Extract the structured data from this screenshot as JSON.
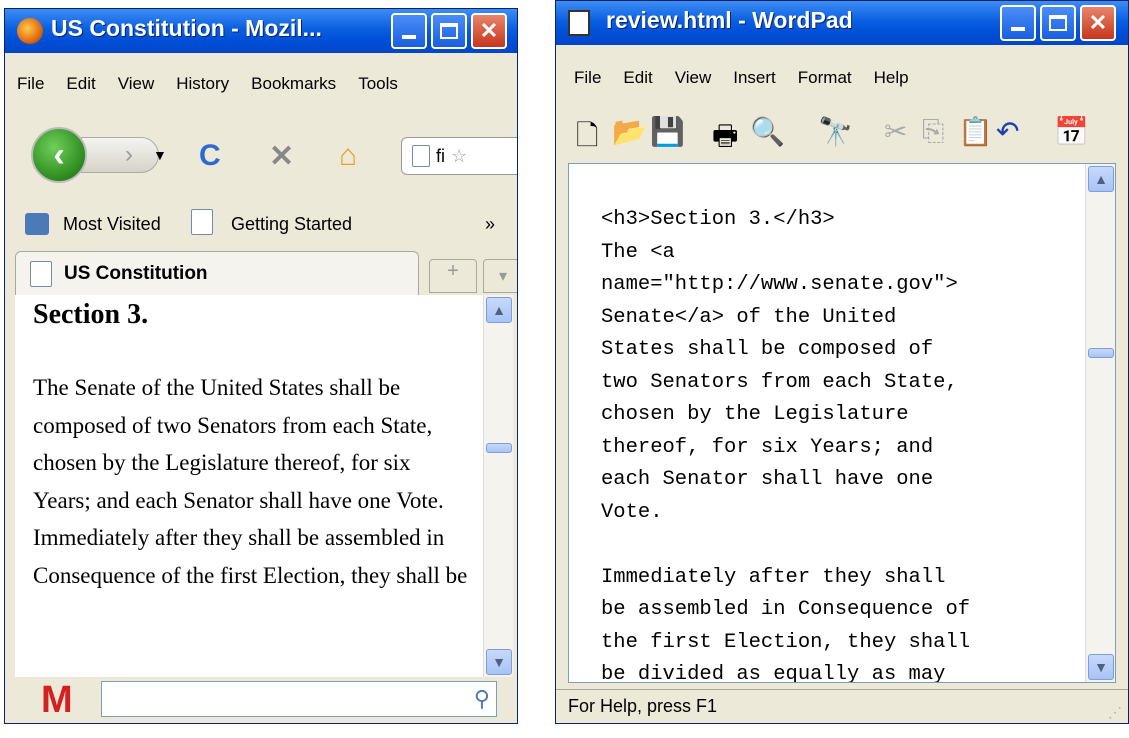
{
  "firefox": {
    "title": "US Constitution - Mozil...",
    "menu": [
      "File",
      "Edit",
      "View",
      "History",
      "Bookmarks",
      "Tools"
    ],
    "url_value": "fi",
    "bookmarks": [
      "Most Visited",
      "Getting Started"
    ],
    "bookmarks_overflow": "»",
    "tab_label": "US Constitution",
    "new_tab": "+",
    "tab_list": "▾",
    "content": {
      "heading": "Section 3.",
      "paragraph": "The Senate of the United States shall be composed of two Senators from each State, chosen by the Legislature thereof, for six Years; and each Senator shall have one Vote. Immediately after they shall be assembled in Consequence of the first Election, they shall be"
    },
    "search_value": ""
  },
  "wordpad": {
    "title": "review.html - WordPad",
    "menu": [
      "File",
      "Edit",
      "View",
      "Insert",
      "Format",
      "Help"
    ],
    "document_text": "<h3>Section 3.</h3>\nThe <a\nname=\"http://www.senate.gov\">\nSenate</a> of the United\nStates shall be composed of\ntwo Senators from each State,\nchosen by the Legislature\nthereof, for six Years; and\neach Senator shall have one\nVote.\n\nImmediately after they shall\nbe assembled in Consequence of\nthe first Election, they shall\nbe divided as equally as may",
    "status": "For Help, press F1"
  },
  "colors": {
    "titlebar": "#0050d8",
    "close_button": "#c5361b",
    "back_button": "#2d8a1e",
    "m_logo": "#d42020"
  }
}
